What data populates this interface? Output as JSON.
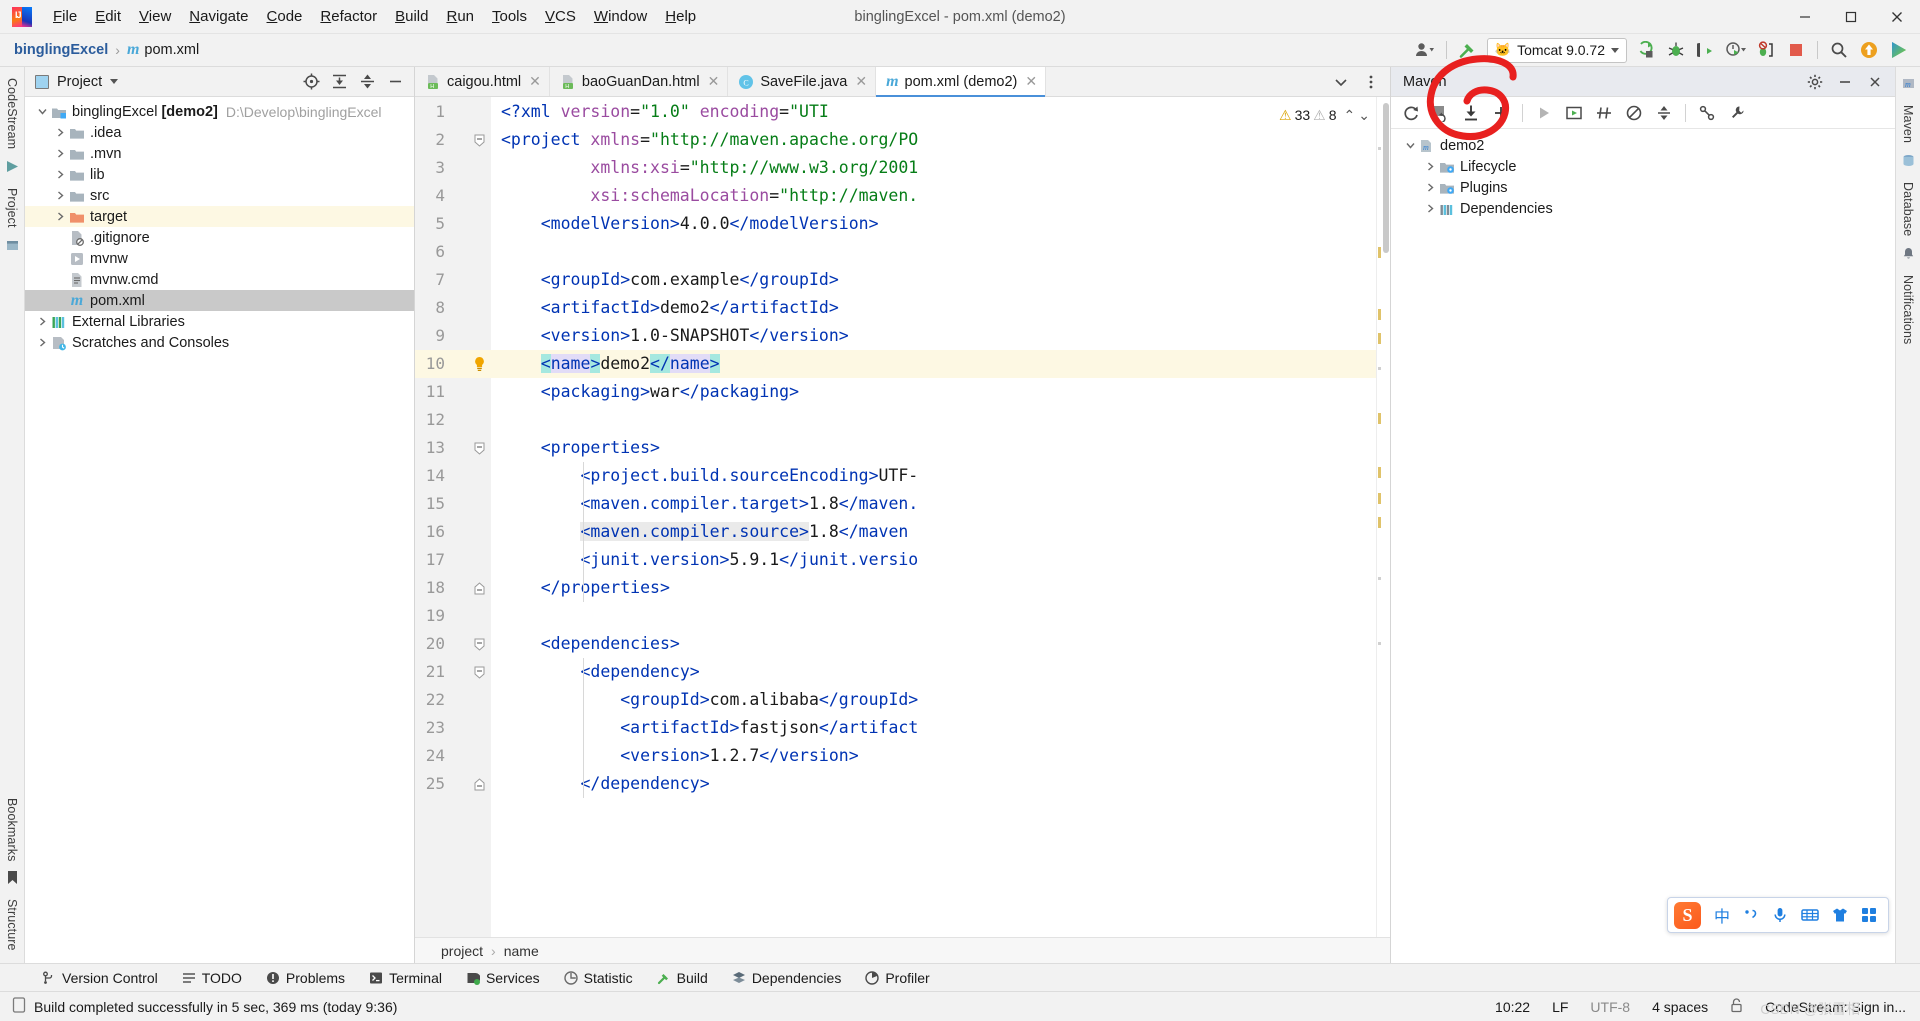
{
  "window": {
    "title": "binglingExcel - pom.xml (demo2)",
    "minimize": "–",
    "maximize": "▢",
    "close": "✕"
  },
  "menubar": {
    "items": [
      "File",
      "Edit",
      "View",
      "Navigate",
      "Code",
      "Refactor",
      "Build",
      "Run",
      "Tools",
      "VCS",
      "Window",
      "Help"
    ]
  },
  "navbar": {
    "project": "binglingExcel",
    "separator": "›",
    "file": "pom.xml",
    "run_config": "Tomcat 9.0.72"
  },
  "project_panel": {
    "title": "Project",
    "tree": [
      {
        "label": "binglingExcel",
        "bold": "[demo2]",
        "path": "D:\\Develop\\binglingExcel",
        "icon": "module-icon",
        "arrow": "down",
        "indent": 0
      },
      {
        "label": ".idea",
        "icon": "folder-icon",
        "arrow": "right",
        "indent": 1
      },
      {
        "label": ".mvn",
        "icon": "folder-icon",
        "arrow": "right",
        "indent": 1
      },
      {
        "label": "lib",
        "icon": "folder-icon",
        "arrow": "right",
        "indent": 1
      },
      {
        "label": "src",
        "icon": "folder-icon",
        "arrow": "right",
        "indent": 1
      },
      {
        "label": "target",
        "icon": "folder-orange-icon",
        "arrow": "right",
        "indent": 1,
        "state": "highlight"
      },
      {
        "label": ".gitignore",
        "icon": "gitignore-icon",
        "arrow": "none",
        "indent": 1
      },
      {
        "label": "mvnw",
        "icon": "script-icon",
        "arrow": "none",
        "indent": 1
      },
      {
        "label": "mvnw.cmd",
        "icon": "cmd-icon",
        "arrow": "none",
        "indent": 1
      },
      {
        "label": "pom.xml",
        "icon": "maven-file-icon",
        "arrow": "none",
        "indent": 1,
        "state": "selected"
      },
      {
        "label": "External Libraries",
        "icon": "libraries-icon",
        "arrow": "right",
        "indent": 0
      },
      {
        "label": "Scratches and Consoles",
        "icon": "scratches-icon",
        "arrow": "right",
        "indent": 0
      }
    ]
  },
  "editor": {
    "tabs": [
      {
        "label": "caigou.html",
        "icon": "html-file-icon",
        "active": false
      },
      {
        "label": "baoGuanDan.html",
        "icon": "html-file-icon",
        "active": false
      },
      {
        "label": "SaveFile.java",
        "icon": "java-class-icon",
        "active": false
      },
      {
        "label": "pom.xml (demo2)",
        "icon": "maven-file-icon",
        "active": true
      }
    ],
    "inspections": {
      "warnings": "33",
      "weak_warnings": "8"
    },
    "breadcrumb": [
      "project",
      "name"
    ],
    "line_numbers": [
      "1",
      "2",
      "3",
      "4",
      "5",
      "6",
      "7",
      "8",
      "9",
      "10",
      "11",
      "12",
      "13",
      "14",
      "15",
      "16",
      "17",
      "18",
      "19",
      "20",
      "21",
      "22",
      "23",
      "24",
      "25"
    ],
    "code_lines": [
      {
        "n": 1,
        "segments": [
          {
            "t": "<?xml ",
            "c": "tg"
          },
          {
            "t": "version",
            "c": "at"
          },
          {
            "t": "=",
            "c": "tx"
          },
          {
            "t": "\"1.0\"",
            "c": "st"
          },
          {
            "t": " encoding",
            "c": "at"
          },
          {
            "t": "=",
            "c": "tx"
          },
          {
            "t": "\"UTI",
            "c": "st"
          }
        ]
      },
      {
        "n": 2,
        "segments": [
          {
            "t": "<project ",
            "c": "tg"
          },
          {
            "t": "xmlns",
            "c": "at"
          },
          {
            "t": "=",
            "c": "tx"
          },
          {
            "t": "\"http://maven.apache.org/PO",
            "c": "st"
          }
        ]
      },
      {
        "n": 3,
        "segments": [
          {
            "t": "         ",
            "c": "tx"
          },
          {
            "t": "xmlns:xsi",
            "c": "at"
          },
          {
            "t": "=",
            "c": "tx"
          },
          {
            "t": "\"http://www.w3.org/2001",
            "c": "st"
          }
        ]
      },
      {
        "n": 4,
        "segments": [
          {
            "t": "         ",
            "c": "tx"
          },
          {
            "t": "xsi:schemaLocation",
            "c": "at"
          },
          {
            "t": "=",
            "c": "tx"
          },
          {
            "t": "\"http://maven.",
            "c": "st"
          }
        ]
      },
      {
        "n": 5,
        "segments": [
          {
            "t": "    ",
            "c": "tx"
          },
          {
            "t": "<modelVersion>",
            "c": "tg"
          },
          {
            "t": "4.0.0",
            "c": "tx"
          },
          {
            "t": "</modelVersion>",
            "c": "tg"
          }
        ]
      },
      {
        "n": 6,
        "segments": []
      },
      {
        "n": 7,
        "segments": [
          {
            "t": "    ",
            "c": "tx"
          },
          {
            "t": "<groupId>",
            "c": "tg"
          },
          {
            "t": "com.example",
            "c": "tx"
          },
          {
            "t": "</groupId>",
            "c": "tg"
          }
        ]
      },
      {
        "n": 8,
        "segments": [
          {
            "t": "    ",
            "c": "tx"
          },
          {
            "t": "<artifactId>",
            "c": "tg"
          },
          {
            "t": "demo2",
            "c": "tx"
          },
          {
            "t": "</artifactId>",
            "c": "tg"
          }
        ]
      },
      {
        "n": 9,
        "segments": [
          {
            "t": "    ",
            "c": "tx"
          },
          {
            "t": "<version>",
            "c": "tg"
          },
          {
            "t": "1.0-SNAPSHOT",
            "c": "tx"
          },
          {
            "t": "</version>",
            "c": "tg"
          }
        ]
      },
      {
        "n": 10,
        "segments": [
          {
            "t": "    ",
            "c": "tx"
          },
          {
            "t": "<",
            "c": "tg sel-cy"
          },
          {
            "t": "name",
            "c": "tg sel-lv"
          },
          {
            "t": ">",
            "c": "tg sel-cy"
          },
          {
            "t": "demo2",
            "c": "tx"
          },
          {
            "t": "</",
            "c": "tg sel-cy"
          },
          {
            "t": "name",
            "c": "tg sel-lv"
          },
          {
            "t": ">",
            "c": "tg sel-cy"
          }
        ],
        "highlight": true,
        "bulb": true
      },
      {
        "n": 11,
        "segments": [
          {
            "t": "    ",
            "c": "tx"
          },
          {
            "t": "<packaging>",
            "c": "tg"
          },
          {
            "t": "war",
            "c": "tx"
          },
          {
            "t": "</packaging>",
            "c": "tg"
          }
        ]
      },
      {
        "n": 12,
        "segments": []
      },
      {
        "n": 13,
        "segments": [
          {
            "t": "    ",
            "c": "tx"
          },
          {
            "t": "<properties>",
            "c": "tg"
          }
        ]
      },
      {
        "n": 14,
        "segments": [
          {
            "t": "        ",
            "c": "tx"
          },
          {
            "t": "<project.build.sourceEncoding>",
            "c": "tg"
          },
          {
            "t": "UTF-",
            "c": "tx"
          }
        ]
      },
      {
        "n": 15,
        "segments": [
          {
            "t": "        ",
            "c": "tx"
          },
          {
            "t": "<maven.compiler.target>",
            "c": "tg"
          },
          {
            "t": "1.8",
            "c": "tx"
          },
          {
            "t": "</maven.",
            "c": "tg"
          }
        ]
      },
      {
        "n": 16,
        "segments": [
          {
            "t": "        ",
            "c": "tx"
          },
          {
            "t": "<maven.compiler.source>",
            "c": "tg wordhl"
          },
          {
            "t": "1.8",
            "c": "tx"
          },
          {
            "t": "</maven",
            "c": "tg"
          }
        ]
      },
      {
        "n": 17,
        "segments": [
          {
            "t": "        ",
            "c": "tx"
          },
          {
            "t": "<junit.version>",
            "c": "tg"
          },
          {
            "t": "5.9.1",
            "c": "tx"
          },
          {
            "t": "</junit.versio",
            "c": "tg"
          }
        ]
      },
      {
        "n": 18,
        "segments": [
          {
            "t": "    ",
            "c": "tx"
          },
          {
            "t": "</properties>",
            "c": "tg"
          }
        ]
      },
      {
        "n": 19,
        "segments": []
      },
      {
        "n": 20,
        "segments": [
          {
            "t": "    ",
            "c": "tx"
          },
          {
            "t": "<dependencies>",
            "c": "tg"
          }
        ]
      },
      {
        "n": 21,
        "segments": [
          {
            "t": "        ",
            "c": "tx"
          },
          {
            "t": "<dependency>",
            "c": "tg"
          }
        ]
      },
      {
        "n": 22,
        "segments": [
          {
            "t": "            ",
            "c": "tx"
          },
          {
            "t": "<groupId>",
            "c": "tg"
          },
          {
            "t": "com.alibaba",
            "c": "tx"
          },
          {
            "t": "</groupId>",
            "c": "tg"
          }
        ]
      },
      {
        "n": 23,
        "segments": [
          {
            "t": "            ",
            "c": "tx"
          },
          {
            "t": "<artifactId>",
            "c": "tg"
          },
          {
            "t": "fastjson",
            "c": "tx"
          },
          {
            "t": "</artifact",
            "c": "tg"
          }
        ]
      },
      {
        "n": 24,
        "segments": [
          {
            "t": "            ",
            "c": "tx"
          },
          {
            "t": "<version>",
            "c": "tg"
          },
          {
            "t": "1.2.7",
            "c": "tx"
          },
          {
            "t": "</version>",
            "c": "tg"
          }
        ]
      },
      {
        "n": 25,
        "segments": [
          {
            "t": "        ",
            "c": "tx"
          },
          {
            "t": "</dependency>",
            "c": "tg"
          }
        ]
      }
    ]
  },
  "maven_panel": {
    "title": "Maven",
    "tree": [
      {
        "label": "demo2",
        "icon": "maven-project-icon",
        "arrow": "down",
        "indent": 0
      },
      {
        "label": "Lifecycle",
        "icon": "lifecycle-icon",
        "arrow": "right",
        "indent": 1
      },
      {
        "label": "Plugins",
        "icon": "plugins-icon",
        "arrow": "right",
        "indent": 1
      },
      {
        "label": "Dependencies",
        "icon": "dependencies-icon",
        "arrow": "right",
        "indent": 1
      }
    ]
  },
  "rails": {
    "left_top": [
      "CodeStream",
      "Project"
    ],
    "left_bottom": [
      "Bookmarks",
      "Structure"
    ],
    "right": [
      "Maven",
      "Database",
      "Notifications"
    ]
  },
  "tool_windows": [
    {
      "label": "Version Control",
      "icon": "branch-icon"
    },
    {
      "label": "TODO",
      "icon": "todo-icon"
    },
    {
      "label": "Problems",
      "icon": "problems-icon"
    },
    {
      "label": "Terminal",
      "icon": "terminal-icon"
    },
    {
      "label": "Services",
      "icon": "services-icon"
    },
    {
      "label": "Statistic",
      "icon": "statistic-icon"
    },
    {
      "label": "Build",
      "icon": "build-icon"
    },
    {
      "label": "Dependencies",
      "icon": "dependencies-icon"
    },
    {
      "label": "Profiler",
      "icon": "profiler-icon"
    }
  ],
  "statusbar": {
    "message": "Build completed successfully in 5 sec, 369 ms (today 9:36)",
    "position": "10:22",
    "line_sep": "LF",
    "encoding": "UTF-8",
    "indent": "4 spaces",
    "codestream": "CodeStream: Sign in..."
  },
  "ime": {
    "brand": "S",
    "mode": "中",
    "items": [
      "punctuation-icon",
      "microphone-icon",
      "keyboard-icon",
      "skin-icon",
      "apps-icon"
    ]
  },
  "watermark": "CSDN @张雪相",
  "colors": {
    "accent": "#4a90d9",
    "tag": "#0033b3",
    "string": "#067d17",
    "attribute": "#9a4ba0",
    "highlight_line": "#fdf8e3",
    "dependency_block": "#f7ecc8",
    "annotation_red": "#e8201f",
    "selection_cyan": "#a5e8e0",
    "selection_lavender": "#e2dcf7"
  }
}
